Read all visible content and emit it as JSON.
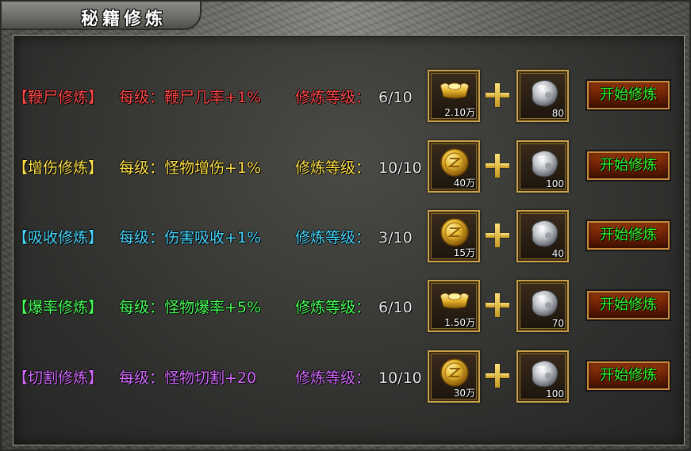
{
  "title": "秘籍修炼",
  "rows": [
    {
      "name": "【鞭尸修炼】",
      "per_label": "每级：",
      "per_value": "鞭尸几率+1%",
      "level_label": "修炼等级：",
      "level_value": "6/10",
      "color": "#ff4a4a",
      "cost_icon": "gold-ingot-icon",
      "cost_amount": "2.10万",
      "stone_count": "80",
      "button": "开始修炼"
    },
    {
      "name": "【增伤修炼】",
      "per_label": "每级：",
      "per_value": "怪物增伤+1%",
      "level_label": "修炼等级：",
      "level_value": "10/10",
      "color": "#ffe24a",
      "cost_icon": "gold-coin-icon",
      "cost_amount": "40万",
      "stone_count": "100",
      "button": "开始修炼"
    },
    {
      "name": "【吸收修炼】",
      "per_label": "每级：",
      "per_value": "伤害吸收+1%",
      "level_label": "修炼等级：",
      "level_value": "3/10",
      "color": "#4ad8ff",
      "cost_icon": "gold-coin-icon",
      "cost_amount": "15万",
      "stone_count": "40",
      "button": "开始修炼"
    },
    {
      "name": "【爆率修炼】",
      "per_label": "每级：",
      "per_value": "怪物爆率+5%",
      "level_label": "修炼等级：",
      "level_value": "6/10",
      "color": "#4aff5a",
      "cost_icon": "gold-ingot-icon",
      "cost_amount": "1.50万",
      "stone_count": "70",
      "button": "开始修炼"
    },
    {
      "name": "【切割修炼】",
      "per_label": "每级：",
      "per_value": "怪物切割+20",
      "level_label": "修炼等级：",
      "level_value": "10/10",
      "color": "#d56bff",
      "cost_icon": "gold-coin-icon",
      "cost_amount": "30万",
      "stone_count": "100",
      "button": "开始修炼"
    }
  ]
}
